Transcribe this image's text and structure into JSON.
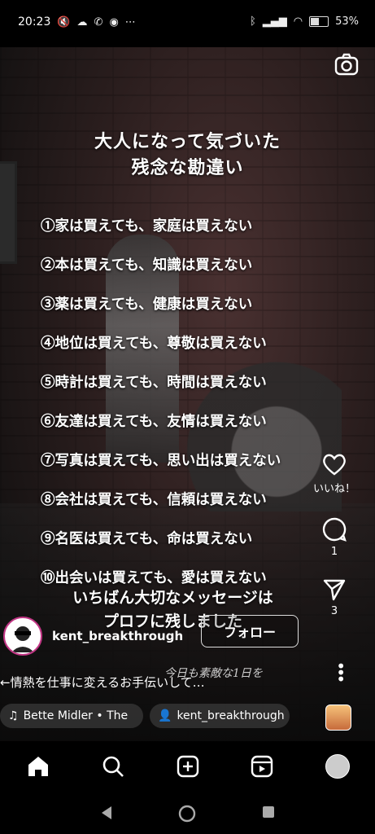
{
  "status": {
    "time": "20:23",
    "battery": "53%"
  },
  "reel": {
    "title_lines": [
      "大人になって気づいた",
      "残念な勘違い"
    ],
    "items": [
      "①家は買えても、家庭は買えない",
      "②本は買えても、知識は買えない",
      "③薬は買えても、健康は買えない",
      "④地位は買えても、尊敬は買えない",
      "⑤時計は買えても、時間は買えない",
      "⑥友達は買えても、友情は買えない",
      "⑦写真は買えても、思い出は買えない",
      "⑧会社は買えても、信頼は買えない",
      "⑨名医は買えても、命は買えない",
      "⑩出会いは買えても、愛は買えない"
    ],
    "closing_lines": [
      "いちばん大切なメッセージは",
      "プロフに残しました"
    ],
    "handwriting": "今日も素敵な1日を"
  },
  "actions": {
    "like_label": "いいね！",
    "comments": "1",
    "shares": "3"
  },
  "author": {
    "username": "kent_breakthrough",
    "follow_label": "フォロー"
  },
  "caption": "←情熱を仕事に変えるお手伝いして…",
  "chips": {
    "music": "Bette Midler • The",
    "user": "kent_breakthrough"
  },
  "icons": {
    "camera": "camera-icon",
    "heart": "heart-icon",
    "comment": "comment-icon",
    "share": "send-icon",
    "more": "more-icon",
    "home": "home-icon",
    "search": "search-icon",
    "create": "create-icon",
    "reels": "reels-icon"
  }
}
